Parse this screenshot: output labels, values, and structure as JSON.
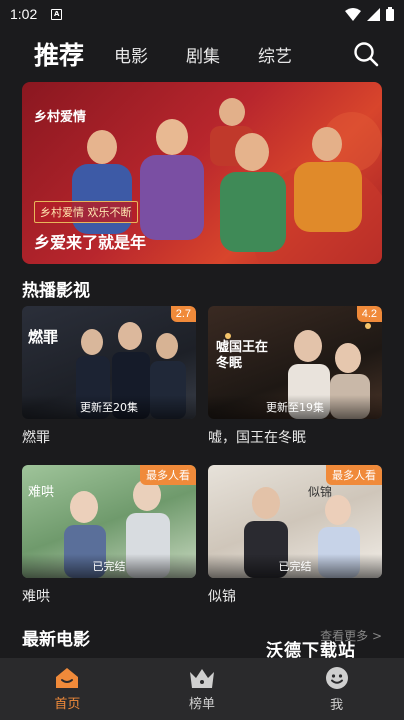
{
  "status": {
    "time": "1:02"
  },
  "nav": {
    "tabs": [
      {
        "label": "推荐",
        "active": true
      },
      {
        "label": "电影"
      },
      {
        "label": "剧集"
      },
      {
        "label": "综艺"
      }
    ]
  },
  "banner": {
    "logo": "乡村爱情",
    "tag": "乡村爱情 欢乐不断",
    "title": "乡爱来了就是年"
  },
  "sections": {
    "hot": "热播影视",
    "movies": "最新电影",
    "more": "查看更多 >"
  },
  "cards": [
    {
      "name": "燃罪",
      "score": "2.7",
      "status": "更新至20集",
      "poster_text": "燃罪"
    },
    {
      "name": "嘘，国王在冬眠",
      "score": "4.2",
      "status": "更新至19集",
      "poster_text": "嘘国王在冬眠"
    },
    {
      "name": "难哄",
      "hot": "最多人看",
      "status": "已完结",
      "poster_text": "难哄"
    },
    {
      "name": "似锦",
      "hot": "最多人看",
      "status": "已完结",
      "poster_text": "似锦"
    }
  ],
  "watermark": "沃德下载站",
  "bottom_nav": [
    {
      "label": "首页",
      "active": true
    },
    {
      "label": "榜单"
    },
    {
      "label": "我"
    }
  ],
  "colors": {
    "accent": "#f08a3a",
    "background": "#1b1b1d",
    "bottom_bar": "#2a2a2c"
  }
}
